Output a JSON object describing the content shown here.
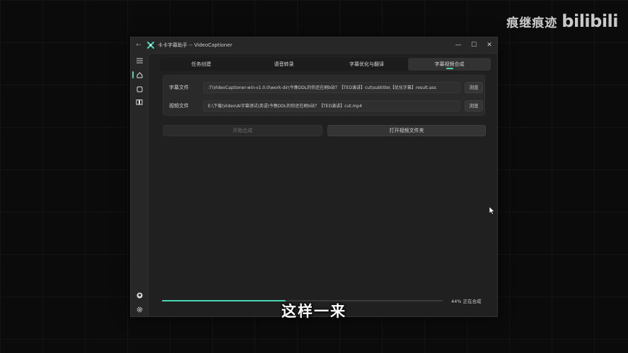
{
  "watermark": {
    "text": "痕继痕迹",
    "logo": "bilibili"
  },
  "window": {
    "title": "卡卡字幕助手 -- VideoCaptioner",
    "controls": {
      "minimize": "—",
      "maximize": "☐",
      "close": "✕"
    }
  },
  "sidebar": {
    "items": [
      {
        "icon": "menu-icon"
      },
      {
        "icon": "home-icon",
        "active": true
      },
      {
        "icon": "square-icon"
      },
      {
        "icon": "book-icon"
      },
      {
        "icon": "github-icon"
      },
      {
        "icon": "gear-icon"
      }
    ]
  },
  "tabs": [
    {
      "label": "任务创建",
      "active": false
    },
    {
      "label": "语音转录",
      "active": false
    },
    {
      "label": "字幕优化与翻译",
      "active": false
    },
    {
      "label": "字幕视频合成",
      "active": true
    }
  ],
  "files": {
    "subtitle": {
      "label": "字幕文件",
      "value": ":T\\VideoCaptioner-win-v1.0.0\\work-dir\\今晚DDL的你还在刷b站？【TED演讲】cut\\subtitle\\【优化字幕】result.ass",
      "browse": "浏览"
    },
    "video": {
      "label": "视频文件",
      "value": "E:\\下载\\Video\\AI字幕测试\\英语\\今晚DDL的你还在刷b站？【TED演讲】cut.mp4",
      "browse": "浏览"
    }
  },
  "actions": {
    "start": "开始合成",
    "open_folder": "打开视频文件夹"
  },
  "progress": {
    "percent": 44,
    "status": "44% 正在合成"
  },
  "caption": "这样一来",
  "colors": {
    "accent": "#4dd6b5",
    "window_bg": "#272727",
    "content_bg": "#202020"
  }
}
